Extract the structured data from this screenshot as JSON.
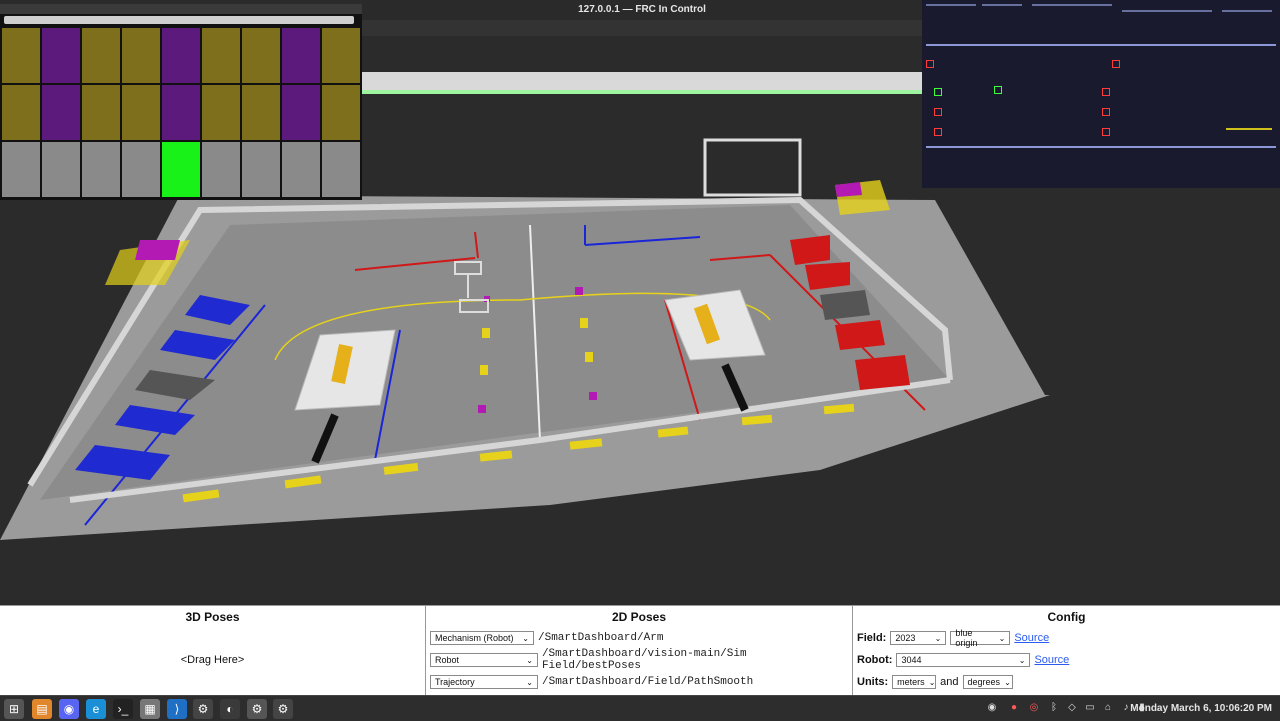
{
  "window": {
    "title": "127.0.0.1 — FRC In Control"
  },
  "grid": {
    "rows": [
      [
        "#7d6f1c",
        "#5b1a7c",
        "#7d6f1c",
        "#7d6f1c",
        "#5b1a7c",
        "#7d6f1c",
        "#7d6f1c",
        "#5b1a7c",
        "#7d6f1c"
      ],
      [
        "#7d6f1c",
        "#5b1a7c",
        "#7d6f1c",
        "#7d6f1c",
        "#5b1a7c",
        "#7d6f1c",
        "#7d6f1c",
        "#5b1a7c",
        "#7d6f1c"
      ],
      [
        "#8a8a8a",
        "#8a8a8a",
        "#8a8a8a",
        "#8a8a8a",
        "#18f218",
        "#8a8a8a",
        "#8a8a8a",
        "#8a8a8a",
        "#8a8a8a"
      ]
    ]
  },
  "sections": {
    "poses3d": {
      "title": "3D Poses",
      "drag": "<Drag Here>"
    },
    "poses2d": {
      "title": "2D Poses",
      "rows": [
        {
          "type": "Mechanism (Robot)",
          "path": "/SmartDashboard/Arm"
        },
        {
          "type": "Robot",
          "path": "/SmartDashboard/vision-main/Sim Field/bestPoses"
        },
        {
          "type": "Trajectory",
          "path": "/SmartDashboard/Field/PathSmooth"
        }
      ]
    },
    "config": {
      "title": "Config",
      "field_label": "Field:",
      "field_value": "2023",
      "origin_value": "blue origin",
      "source": "Source",
      "robot_label": "Robot:",
      "robot_value": "3044",
      "units_label": "Units:",
      "units_value": "meters",
      "and_text": "and",
      "angle_value": "degrees"
    }
  },
  "taskbar": {
    "clock": "Monday March  6, 10:06:20 PM",
    "apps": [
      "menu-icon",
      "files-icon",
      "discord-icon",
      "edge-icon",
      "terminal-icon",
      "grid-app-icon",
      "vscode-icon",
      "gear-icon",
      "advantagescope-icon",
      "gear-icon",
      "gear-icon"
    ]
  },
  "colors": {
    "alliance_red": "#d01818",
    "alliance_blue": "#1a25d8",
    "floor": "#9a9a9a",
    "accent_yellow": "#e6d21a"
  }
}
